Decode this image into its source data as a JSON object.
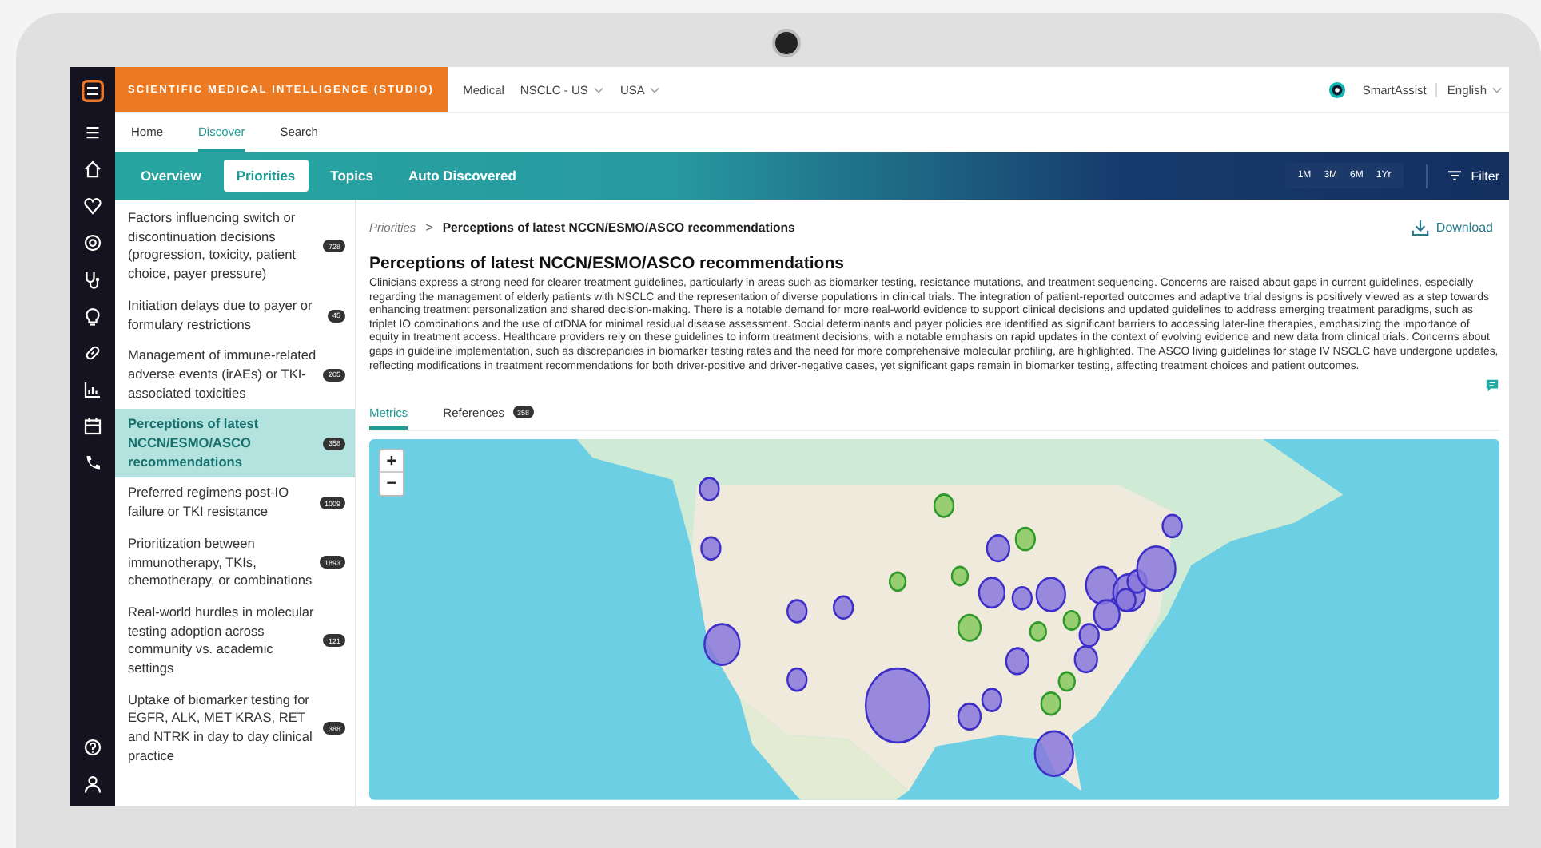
{
  "app": {
    "brand": "SCIENTIFIC MEDICAL INTELLIGENCE (STUDIO)",
    "context": [
      {
        "label": "Medical",
        "dropdown": false
      },
      {
        "label": "NSCLC - US",
        "dropdown": true
      },
      {
        "label": "USA",
        "dropdown": true
      }
    ],
    "assistant": "SmartAssist",
    "language": "English"
  },
  "nav_tabs": [
    {
      "label": "Home",
      "selected": false
    },
    {
      "label": "Discover",
      "selected": true
    },
    {
      "label": "Search",
      "selected": false
    }
  ],
  "sub_tabs": [
    {
      "label": "Overview",
      "selected": false
    },
    {
      "label": "Priorities",
      "selected": true
    },
    {
      "label": "Topics",
      "selected": false
    },
    {
      "label": "Auto Discovered",
      "selected": false
    }
  ],
  "periods": [
    "1M",
    "3M",
    "6M",
    "1Yr"
  ],
  "filter": "Filter",
  "topics": [
    {
      "title": "Factors influencing switch or discontinuation decisions (progression, toxicity, patient choice, payer pressure)",
      "count": "728",
      "selected": false
    },
    {
      "title": "Initiation delays due to payer or formulary restrictions",
      "count": "45",
      "selected": false
    },
    {
      "title": "Management of immune-related adverse events (irAEs) or TKI- associated toxicities",
      "count": "205",
      "selected": false
    },
    {
      "title": "Perceptions of latest NCCN/ESMO/ASCO recommendations",
      "count": "358",
      "selected": true
    },
    {
      "title": "Preferred regimens post-IO failure or TKI resistance",
      "count": "1009",
      "selected": false
    },
    {
      "title": "Prioritization between immunotherapy, TKIs, chemotherapy, or combinations",
      "count": "1893",
      "selected": false
    },
    {
      "title": "Real-world hurdles in molecular testing adoption across community vs. academic settings",
      "count": "121",
      "selected": false
    },
    {
      "title": "Uptake of biomarker testing for EGFR, ALK, MET KRAS, RET and NTRK in day to day clinical practice",
      "count": "388",
      "selected": false
    }
  ],
  "breadcrumb": {
    "parent": "Priorities",
    "separator": ">",
    "current": "Perceptions of latest NCCN/ESMO/ASCO recommendations"
  },
  "download": "Download",
  "detail": {
    "title": "Perceptions of latest NCCN/ESMO/ASCO recommendations",
    "summary": "Clinicians express a strong need for clearer treatment guidelines, particularly in areas such as biomarker testing, resistance mutations, and treatment sequencing. Concerns are raised about gaps in current guidelines, especially regarding the management of elderly patients with NSCLC and the representation of diverse populations in clinical trials. The integration of patient-reported outcomes and adaptive trial designs is positively viewed as a step towards enhancing treatment personalization and shared decision-making. There is a notable demand for more real-world evidence to support clinical decisions and updated guidelines to address emerging treatment paradigms, such as triplet IO combinations and the use of ctDNA for minimal residual disease assessment. Social determinants and payer policies are identified as significant barriers to accessing later-line therapies, emphasizing the importance of equity in treatment access. Healthcare providers rely on these guidelines to inform treatment decisions, with a notable emphasis on rapid updates in the context of evolving evidence and new data from clinical trials. Concerns about gaps in guideline implementation, such as discrepancies in biomarker testing rates and the need for more comprehensive molecular profiling, are highlighted. The ASCO living guidelines for stage IV NSCLC have undergone updates, reflecting modifications in treatment recommendations for both driver-positive and driver-negative cases, yet significant gaps remain in biomarker testing, affecting treatment choices and patient outcomes."
  },
  "detail_tabs": [
    {
      "label": "Metrics",
      "selected": true
    },
    {
      "label": "References",
      "count": "358",
      "selected": false
    }
  ],
  "map": {
    "zoom_in": "+",
    "zoom_out": "−"
  }
}
